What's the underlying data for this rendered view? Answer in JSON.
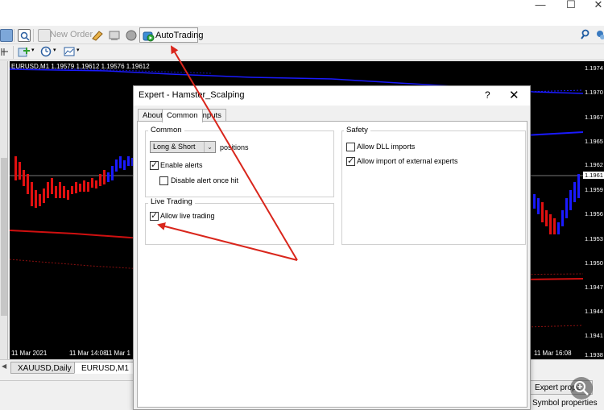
{
  "toolbar": {
    "new_order_label": "New Order",
    "autotrading_label": "AutoTrading"
  },
  "chart": {
    "info": "EURUSD,M1  1.19579 1.19612 1.19576 1.19612",
    "dates": [
      "11 Mar 2021",
      "11 Mar 14:08",
      "11 Mar 1",
      "11 Mar 16:08"
    ],
    "prices": [
      "1.1974",
      "1.1970",
      "1.1967",
      "1.1965",
      "1.1962",
      "1.1961",
      "1.1959",
      "1.1956",
      "1.1953",
      "1.1950",
      "1.1947",
      "1.1944",
      "1.1941",
      "1.1938"
    ]
  },
  "tabs": [
    "XAUUSD,Daily",
    "EURUSD,M1"
  ],
  "side_buttons": {
    "expert_properties": "Expert prope",
    "symbol_properties": "Symbol properties"
  },
  "dialog": {
    "title": "Expert - Hamster_Scalping",
    "help": "?",
    "close": "✕",
    "tabs": [
      "About",
      "Common",
      "Inputs"
    ],
    "common": {
      "group_label": "Common",
      "positions_value": "Long & Short",
      "positions_label": "positions",
      "enable_alerts": "Enable alerts",
      "disable_alert_once_hit": "Disable alert once hit"
    },
    "live_trading": {
      "group_label": "Live Trading",
      "allow_live_trading": "Allow live trading"
    },
    "safety": {
      "group_label": "Safety",
      "allow_dll_imports": "Allow DLL imports",
      "allow_external_experts": "Allow import of external experts"
    },
    "checkboxes": {
      "enable_alerts": true,
      "disable_alert_once_hit": false,
      "allow_live_trading": true,
      "allow_dll_imports": false,
      "allow_external_experts": true
    }
  },
  "colors": {
    "annotation_arrow": "#d9261c",
    "bull_candle": "#1a1aff",
    "bear_candle": "#e01010",
    "chart_bg": "#000000"
  }
}
